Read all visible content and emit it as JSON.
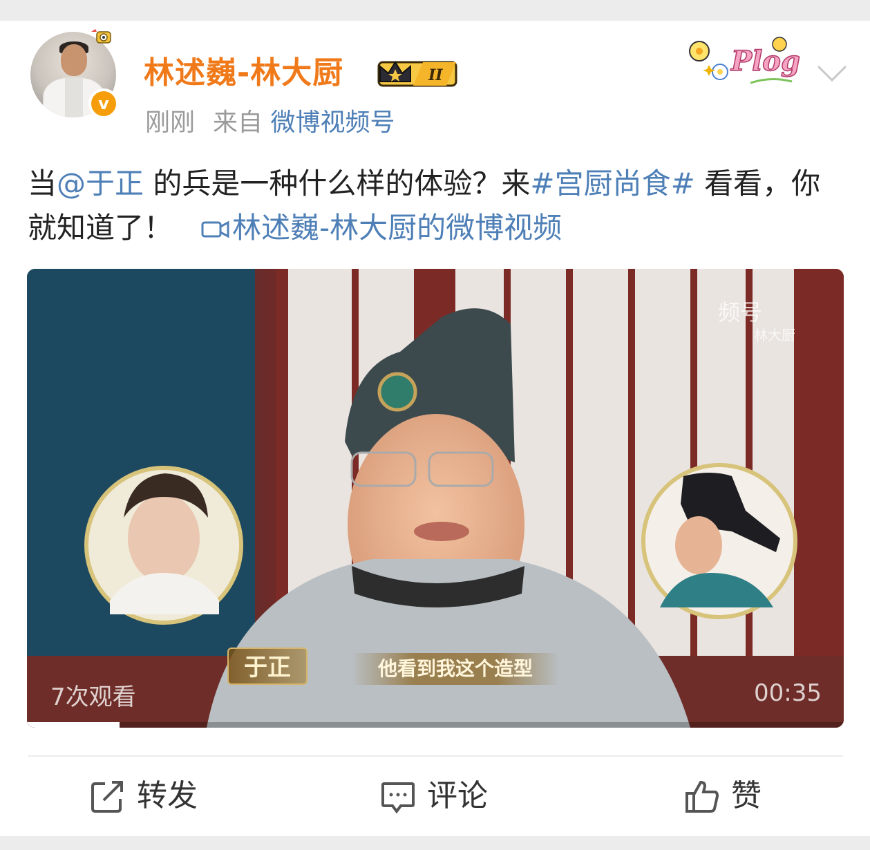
{
  "user": {
    "name": "林述巍-林大厨",
    "level_badge": "II",
    "verified_badge": "v",
    "time": "刚刚",
    "from_prefix": "来自",
    "source": "微博视频号"
  },
  "decor": {
    "plog_sticker": "Plog"
  },
  "post": {
    "text_part1": "当",
    "mention": "@于正",
    "text_part2": " 的兵是一种什么样的体验？来",
    "hashtag": "#宫厨尚食#",
    "text_part3": " 看看，你就知道了！",
    "video_link": "林述巍-林大厨的微博视频"
  },
  "video": {
    "watermark_line1": "频号",
    "watermark_line2": "林大厨",
    "views": "7次观看",
    "duration": "00:35",
    "name_caption": "于正",
    "subtitle": "他看到我这个造型",
    "progress_fraction": 0.113
  },
  "actions": {
    "repost": "转发",
    "comment": "评论",
    "like": "赞"
  },
  "colors": {
    "username": "#f07a1a",
    "link": "#4e7fb6",
    "meta": "#9a9a9a",
    "verified": "#f59d0a"
  }
}
